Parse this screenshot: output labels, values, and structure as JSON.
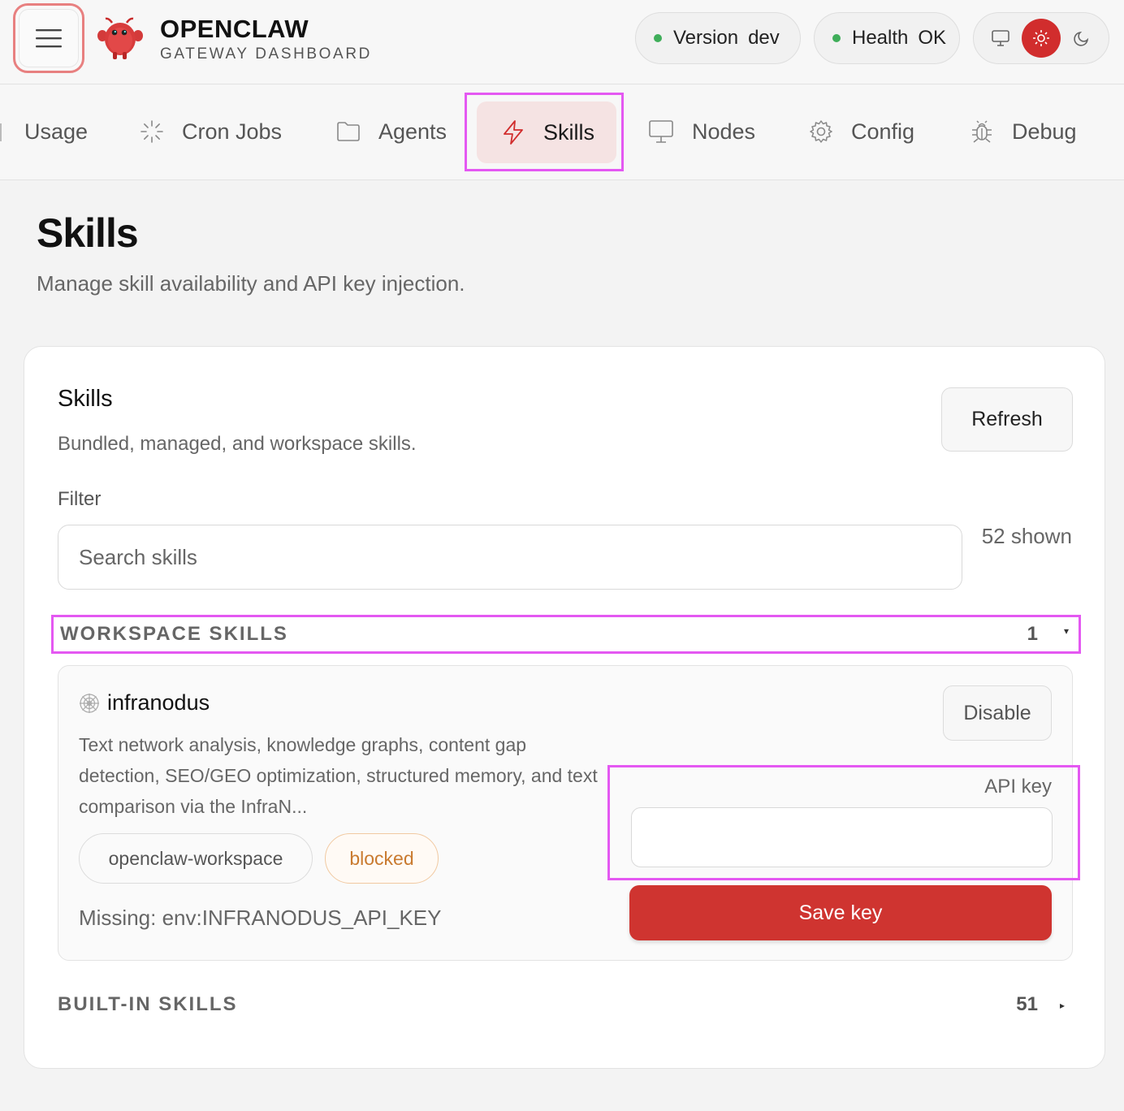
{
  "header": {
    "brand_title": "OPENCLAW",
    "brand_subtitle": "GATEWAY DASHBOARD",
    "version_label": "Version",
    "version_value": "dev",
    "health_label": "Health",
    "health_value": "OK",
    "status_color": "#3fae5a",
    "accent_color": "#d12d2d"
  },
  "tabs": [
    {
      "label": "Usage",
      "icon": "none"
    },
    {
      "label": "Cron Jobs",
      "icon": "loader-icon"
    },
    {
      "label": "Agents",
      "icon": "folder-icon"
    },
    {
      "label": "Skills",
      "icon": "zap-icon",
      "active": true
    },
    {
      "label": "Nodes",
      "icon": "monitor-icon"
    },
    {
      "label": "Config",
      "icon": "gear-icon"
    },
    {
      "label": "Debug",
      "icon": "bug-icon"
    }
  ],
  "page": {
    "title": "Skills",
    "subtitle": "Manage skill availability and API key injection."
  },
  "card": {
    "title": "Skills",
    "subtitle": "Bundled, managed, and workspace skills.",
    "refresh_label": "Refresh",
    "filter_label": "Filter",
    "search_placeholder": "Search skills",
    "search_value": "",
    "shown_count": "52 shown"
  },
  "groups": {
    "workspace": {
      "label": "WORKSPACE SKILLS",
      "count": "1",
      "caret": "▾"
    },
    "builtin": {
      "label": "BUILT-IN SKILLS",
      "count": "51",
      "caret": "▸"
    }
  },
  "skill": {
    "icon": "web-icon",
    "name": "infranodus",
    "description": "Text network analysis, knowledge graphs, content gap detection, SEO/GEO optimization, structured memory, and text comparison via the InfraN...",
    "source_chip": "openclaw-workspace",
    "status_chip": "blocked",
    "missing": "Missing: env:INFRANODUS_API_KEY",
    "disable_label": "Disable",
    "api_key_label": "API key",
    "api_key_value": "",
    "save_label": "Save key"
  }
}
